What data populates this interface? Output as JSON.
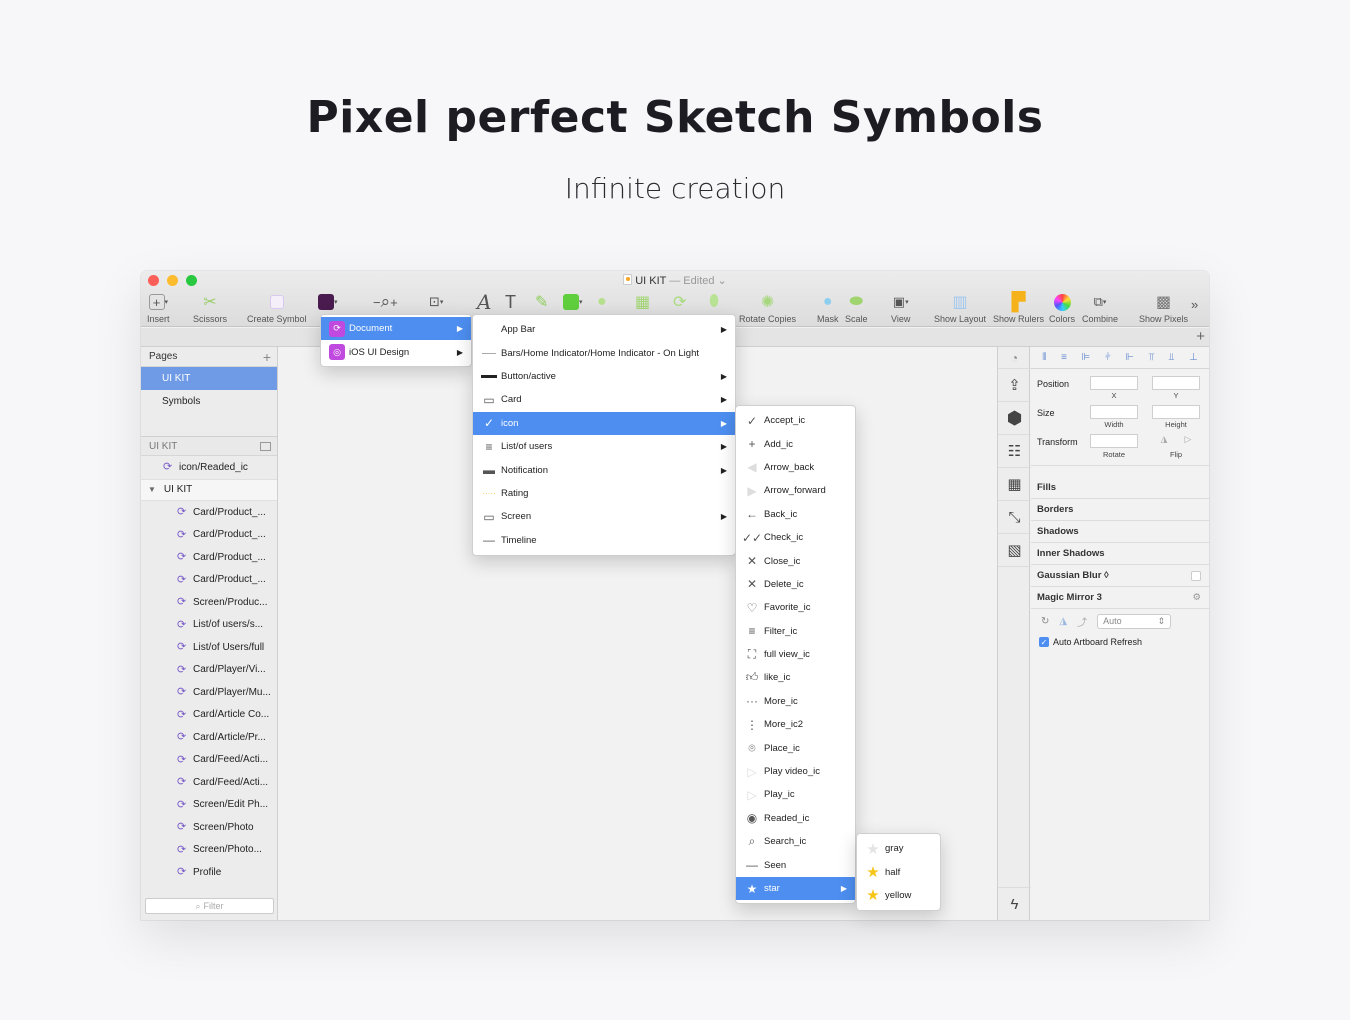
{
  "hero": {
    "title": "Pixel perfect Sketch Symbols",
    "subtitle": "Infinite creation"
  },
  "window": {
    "title": "UI KIT",
    "edited": "— Edited ⌄"
  },
  "toolbar": {
    "insert": "Insert",
    "scissors": "Scissors",
    "create_symbol": "Create Symbol",
    "rotate_copies": "Rotate Copies",
    "mask": "Mask",
    "scale": "Scale",
    "view": "View",
    "show_layout": "Show Layout",
    "show_rulers": "Show Rulers",
    "colors": "Colors",
    "combine": "Combine",
    "show_pixels": "Show Pixels",
    "more": "»"
  },
  "pages": {
    "header": "Pages",
    "items": [
      "UI KIT",
      "Symbols"
    ]
  },
  "layers": {
    "header": "UI KIT",
    "top_item": "icon/Readed_ic",
    "group": "UI KIT",
    "items": [
      "Card/Product_...",
      "Card/Product_...",
      "Card/Product_...",
      "Card/Product_...",
      "Screen/Produc...",
      "List/of users/s...",
      "List/of Users/full",
      "Card/Player/Vi...",
      "Card/Player/Mu...",
      "Card/Article Co...",
      "Card/Article/Pr...",
      "Card/Feed/Acti...",
      "Card/Feed/Acti...",
      "Screen/Edit Ph...",
      "Screen/Photo",
      "Screen/Photo...",
      "Profile"
    ],
    "filter_placeholder": "Filter"
  },
  "menu1": {
    "items": [
      "Document",
      "iOS UI Design"
    ]
  },
  "menu2": {
    "items": [
      "App Bar",
      "Bars/Home Indicator/Home Indicator - On Light",
      "Button/active",
      "Card",
      "icon",
      "List/of users",
      "Notification",
      "Rating",
      "Screen",
      "Timeline"
    ]
  },
  "menu3": {
    "items": [
      "Accept_ic",
      "Add_ic",
      "Arrow_back",
      "Arrow_forward",
      "Back_ic",
      "Check_ic",
      "Close_ic",
      "Delete_ic",
      "Favorite_ic",
      "Filter_ic",
      "full view_ic",
      "like_ic",
      "More_ic",
      "More_ic2",
      "Place_ic",
      "Play video_ic",
      "Play_ic",
      "Readed_ic",
      "Search_ic",
      "Seen",
      "star"
    ]
  },
  "menu4": {
    "items": [
      "gray",
      "half",
      "yellow"
    ]
  },
  "inspector": {
    "position": "Position",
    "size": "Size",
    "transform": "Transform",
    "x": "X",
    "y": "Y",
    "width": "Width",
    "height": "Height",
    "rotate": "Rotate",
    "flip": "Flip",
    "sections": [
      "Fills",
      "Borders",
      "Shadows",
      "Inner Shadows",
      "Gaussian Blur ◊",
      "Magic Mirror 3"
    ],
    "auto": "Auto",
    "auto_refresh": "Auto Artboard Refresh"
  },
  "colors": {
    "selection": "#4d8ef0",
    "page_selection": "#6f9be6",
    "symbol": "#7b5cc8",
    "badge": "#c04ae0"
  }
}
